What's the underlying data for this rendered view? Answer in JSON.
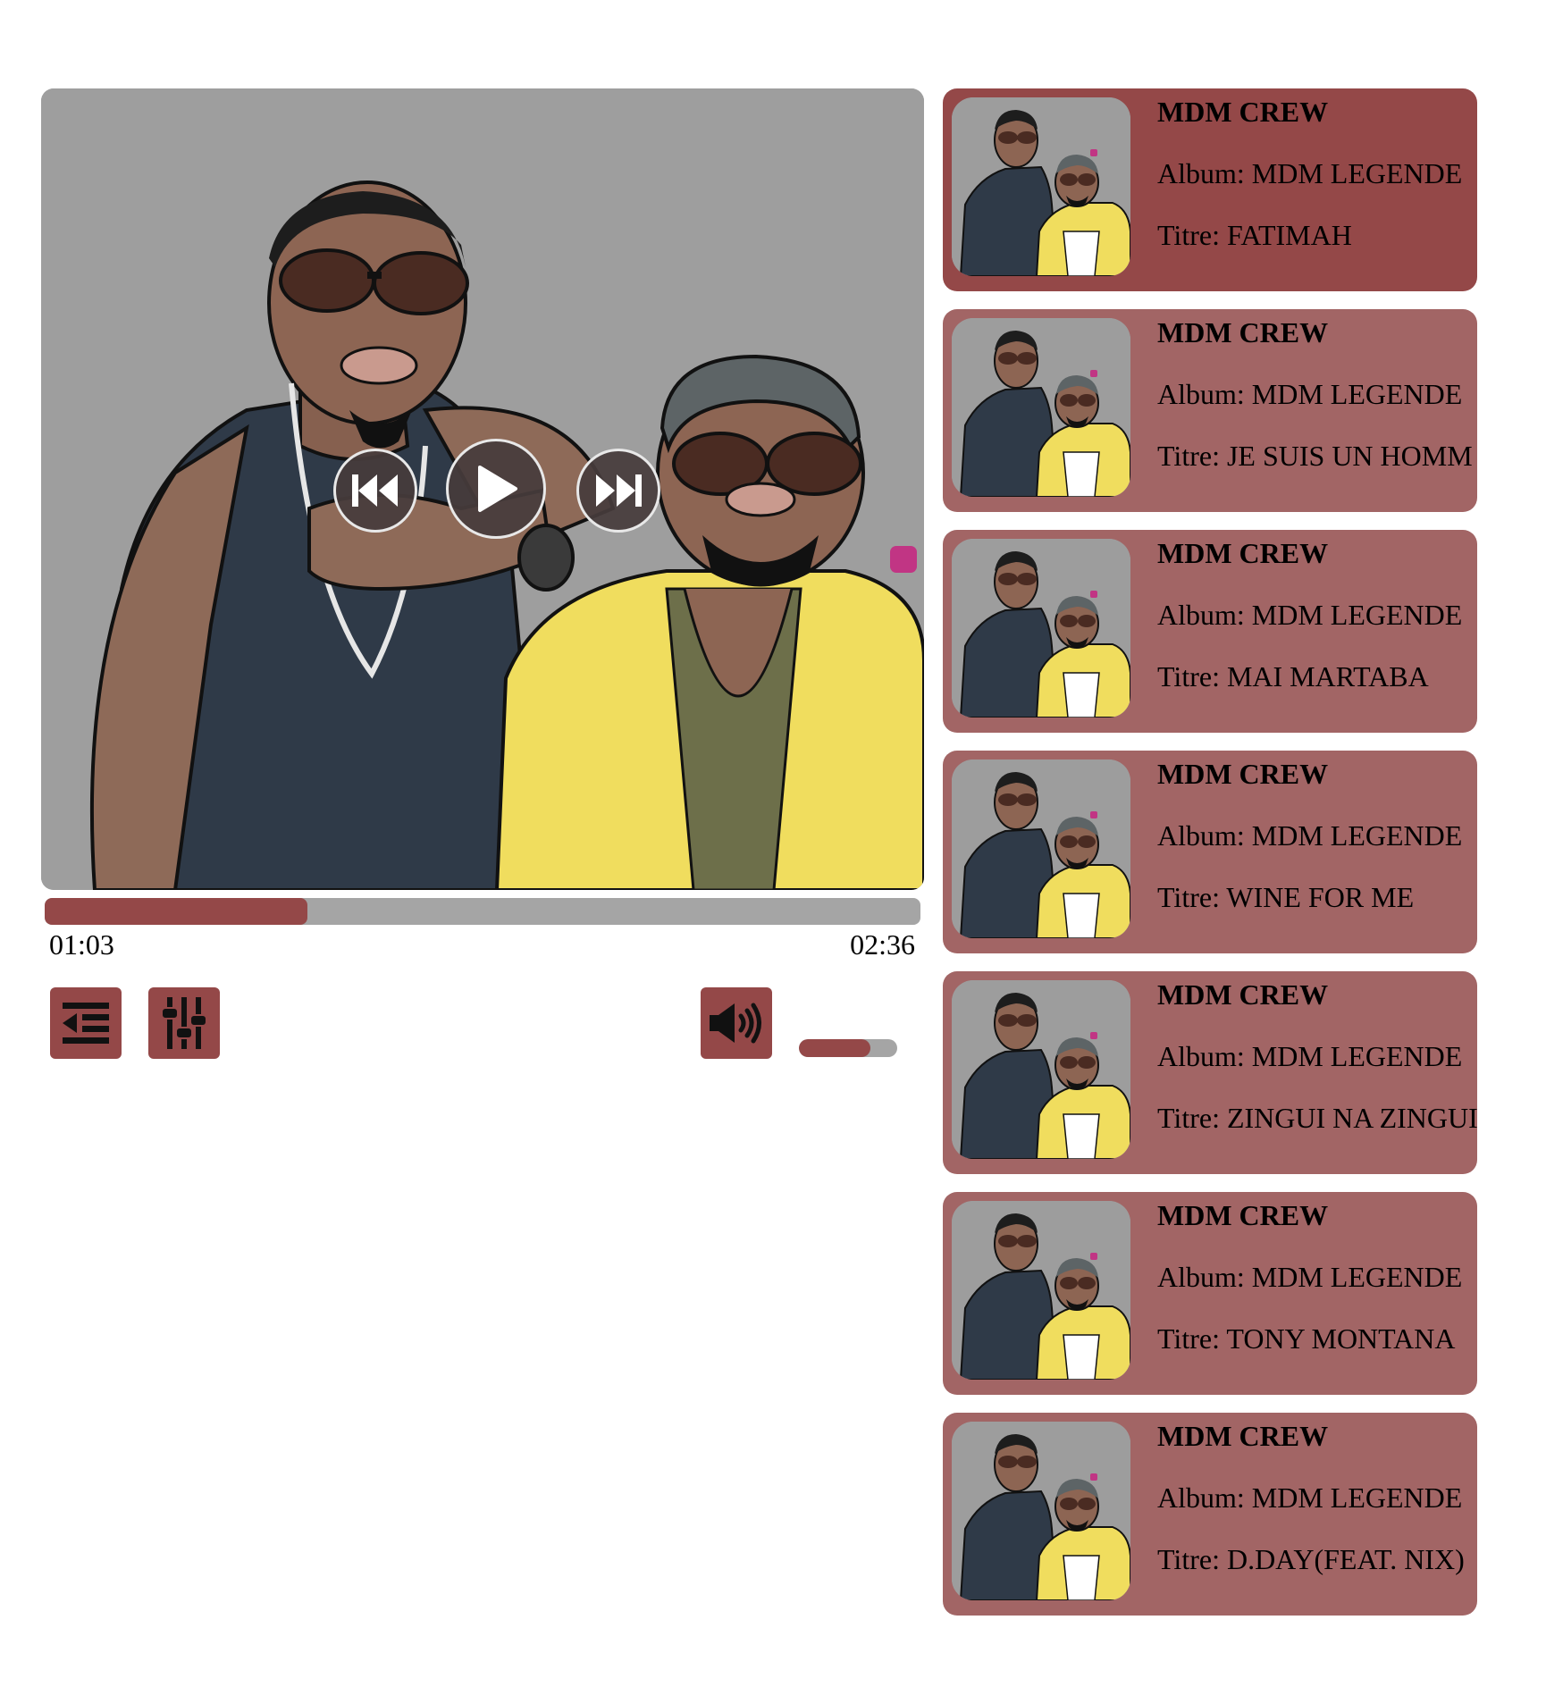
{
  "player": {
    "cover_alt": "album-artwork",
    "controls": {
      "prev_icon": "skip-back-icon",
      "play_icon": "play-icon",
      "next_icon": "skip-forward-icon"
    },
    "progress": 0.3,
    "current_time": "01:03",
    "total_time": "02:36",
    "buttons": {
      "playlist_icon": "list-indent-icon",
      "equalizer_icon": "sliders-icon",
      "volume_icon": "volume-icon"
    },
    "volume": 0.73
  },
  "colors": {
    "accent": "#944848",
    "card": "#a26565",
    "track_bg": "#a5a5a5"
  },
  "playlist": {
    "tracks": [
      {
        "artist": "MDM CREW",
        "album": "Album: MDM LEGENDE",
        "title": "Titre: FATIMAH",
        "active": true
      },
      {
        "artist": "MDM CREW",
        "album": "Album: MDM LEGENDE",
        "title": "Titre: JE SUIS UN HOMM",
        "active": false
      },
      {
        "artist": "MDM CREW",
        "album": "Album: MDM LEGENDE",
        "title": "Titre: MAI MARTABA",
        "active": false
      },
      {
        "artist": "MDM CREW",
        "album": "Album: MDM LEGENDE",
        "title": "Titre: WINE FOR ME",
        "active": false
      },
      {
        "artist": "MDM CREW",
        "album": "Album: MDM LEGENDE",
        "title": "Titre: ZINGUI NA ZINGUI",
        "active": false
      },
      {
        "artist": "MDM CREW",
        "album": "Album: MDM LEGENDE",
        "title": "Titre: TONY MONTANA",
        "active": false
      },
      {
        "artist": "MDM CREW",
        "album": "Album: MDM LEGENDE",
        "title": "Titre: D.DAY(FEAT. NIX)",
        "active": false
      }
    ]
  }
}
